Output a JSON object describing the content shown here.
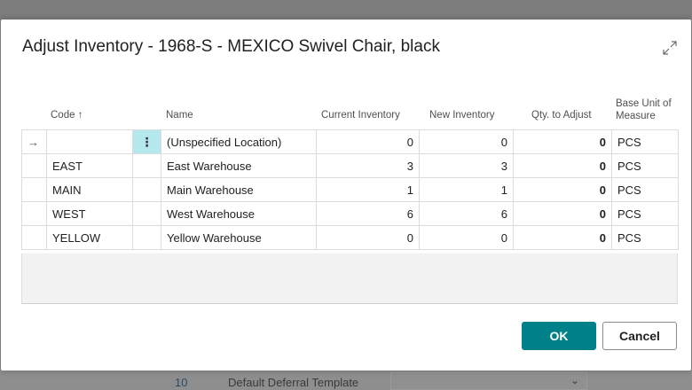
{
  "dialog": {
    "title": "Adjust Inventory - 1968-S - MEXICO Swivel Chair, black"
  },
  "columns": {
    "code": "Code",
    "code_sort": "↑",
    "name": "Name",
    "current": "Current Inventory",
    "new": "New Inventory",
    "qty": "Qty. to Adjust",
    "base_uom": "Base Unit of Measure"
  },
  "rows": [
    {
      "code": "",
      "name": "(Unspecified Location)",
      "current": "0",
      "new": "0",
      "qty": "0",
      "uom": "PCS",
      "marker": "→",
      "ellipsis": "⋮"
    },
    {
      "code": "EAST",
      "name": "East Warehouse",
      "current": "3",
      "new": "3",
      "qty": "0",
      "uom": "PCS"
    },
    {
      "code": "MAIN",
      "name": "Main Warehouse",
      "current": "1",
      "new": "1",
      "qty": "0",
      "uom": "PCS"
    },
    {
      "code": "WEST",
      "name": "West Warehouse",
      "current": "6",
      "new": "6",
      "qty": "0",
      "uom": "PCS"
    },
    {
      "code": "YELLOW",
      "name": "Yellow Warehouse",
      "current": "0",
      "new": "0",
      "qty": "0",
      "uom": "PCS"
    }
  ],
  "buttons": {
    "ok": "OK",
    "cancel": "Cancel"
  },
  "background": {
    "line_no": "10",
    "field_label": "Default Deferral Template",
    "field_chevron": "⌄"
  },
  "colors": {
    "accent": "#00818a",
    "active_cell": "#b5e8ee"
  }
}
